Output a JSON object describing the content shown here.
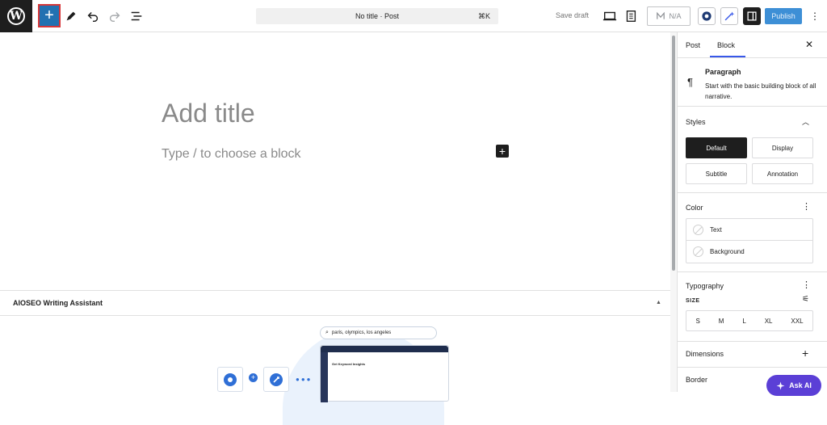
{
  "header": {
    "document_bar": "No title · Post",
    "shortcut": "⌘K",
    "save_draft": "Save draft",
    "seo_score": "N/A",
    "publish": "Publish"
  },
  "editor": {
    "title_placeholder": "Add title",
    "block_placeholder": "Type / to choose a block"
  },
  "aioseo": {
    "title": "AIOSEO Writing Assistant",
    "search_text": "paris, olympics, los angeles",
    "window_heading": "Get Keyword Insights"
  },
  "sidebar": {
    "tabs": [
      "Post",
      "Block"
    ],
    "block": {
      "name": "Paragraph",
      "description": "Start with the basic building block of all narrative."
    },
    "styles": {
      "title": "Styles",
      "options": [
        "Default",
        "Display",
        "Subtitle",
        "Annotation"
      ]
    },
    "color": {
      "title": "Color",
      "items": [
        "Text",
        "Background"
      ]
    },
    "typography": {
      "title": "Typography",
      "size_label": "SIZE",
      "sizes": [
        "S",
        "M",
        "L",
        "XL",
        "XXL"
      ]
    },
    "dimensions": {
      "title": "Dimensions"
    },
    "border": {
      "title": "Border"
    }
  },
  "ask_ai": "Ask AI",
  "colors": {
    "accent": "#3858e9",
    "publish": "#3d8fd6",
    "inserter": "#2271b1",
    "highlight": "#d63638",
    "ask_ai": "#5b3fd6"
  }
}
